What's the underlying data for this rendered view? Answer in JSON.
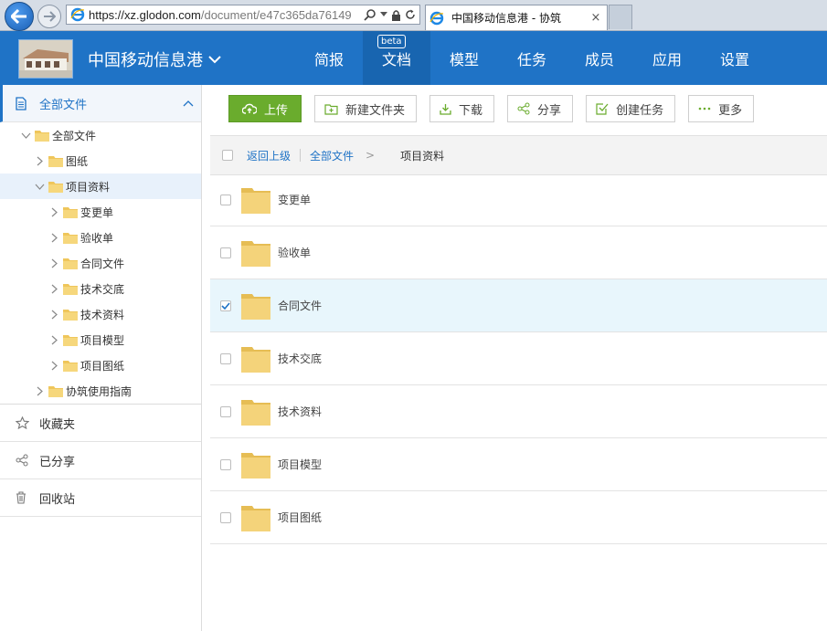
{
  "browser": {
    "url_prefix": "https://",
    "url_domain": "xz.glodon.com",
    "url_path": "/document/e47c365da76149",
    "tab_title": "中国移动信息港 - 协筑",
    "tab_close": "×"
  },
  "header": {
    "project_name": "中国移动信息港",
    "nav": [
      "简报",
      "文档",
      "模型",
      "任务",
      "成员",
      "应用",
      "设置"
    ],
    "active_nav": "文档",
    "beta_badge": "beta",
    "color": "#1f73c6"
  },
  "sidebar": {
    "all_files": "全部文件",
    "tree": {
      "root": "全部文件",
      "drawings": "图纸",
      "project_docs": "项目资料",
      "children": [
        "变更单",
        "验收单",
        "合同文件",
        "技术交底",
        "技术资料",
        "项目模型",
        "项目图纸"
      ],
      "guide": "协筑使用指南"
    },
    "favorites": "收藏夹",
    "shared": "已分享",
    "recycle": "回收站"
  },
  "toolbar": {
    "upload": "上传",
    "new_folder": "新建文件夹",
    "download": "下载",
    "share": "分享",
    "create_task": "创建任务",
    "more": "更多"
  },
  "breadcrumb": {
    "back": "返回上级",
    "all_files": "全部文件",
    "separator": ">",
    "current": "项目资料"
  },
  "files": [
    {
      "name": "变更单",
      "checked": false
    },
    {
      "name": "验收单",
      "checked": false
    },
    {
      "name": "合同文件",
      "checked": true
    },
    {
      "name": "技术交底",
      "checked": false
    },
    {
      "name": "技术资料",
      "checked": false
    },
    {
      "name": "项目模型",
      "checked": false
    },
    {
      "name": "项目图纸",
      "checked": false
    }
  ]
}
